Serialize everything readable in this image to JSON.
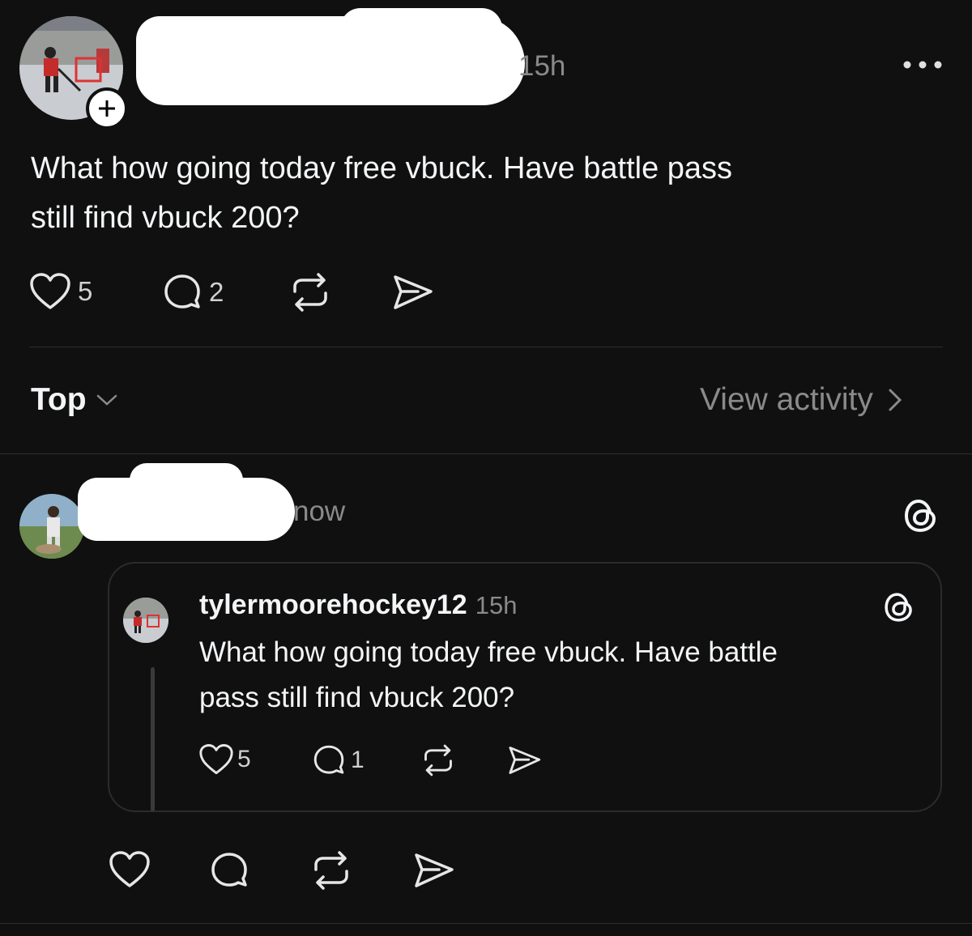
{
  "post": {
    "timestamp": "15h",
    "text_line1": "What how going today free vbuck. Have battle pass",
    "text_line2": "still find vbuck 200?",
    "likes": "5",
    "replies": "2",
    "more_icon": "ellipsis-icon",
    "follow_icon": "plus-icon"
  },
  "sort": {
    "label": "Top",
    "view_activity": "View activity"
  },
  "reply": {
    "timestamp": "now",
    "quoted": {
      "username": "tylermoorehockey12",
      "timestamp": "15h",
      "text_line1": "What how going today free vbuck. Have battle",
      "text_line2": "pass still find vbuck 200?",
      "likes": "5",
      "replies": "1"
    }
  },
  "colors": {
    "background": "#101010",
    "text": "#f3f5f7",
    "muted": "#8a8a8a",
    "divider": "#2e2e2e"
  }
}
